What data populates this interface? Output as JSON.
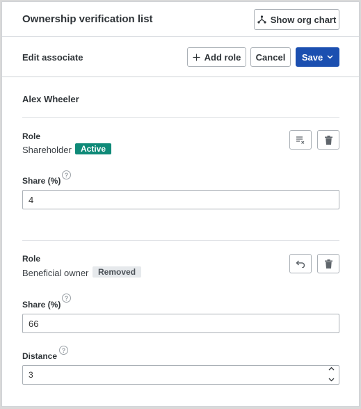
{
  "header": {
    "title": "Ownership verification list",
    "org_chart_label": "Show org chart"
  },
  "subheader": {
    "title": "Edit associate",
    "add_role_label": "Add role",
    "cancel_label": "Cancel",
    "save_label": "Save"
  },
  "associate": {
    "name": "Alex Wheeler"
  },
  "roles": [
    {
      "heading": "Role",
      "type": "Shareholder",
      "status": "Active",
      "share_label": "Share (%)",
      "share_value": "4",
      "action_icon": "clear-format-icon"
    },
    {
      "heading": "Role",
      "type": "Beneficial owner",
      "status": "Removed",
      "share_label": "Share (%)",
      "share_value": "66",
      "distance_label": "Distance",
      "distance_value": "3",
      "action_icon": "undo-icon"
    }
  ],
  "help_glyph": "?",
  "colors": {
    "primary": "#1b4fb0",
    "active_badge": "#0f8a78",
    "removed_badge": "#e6e9ec"
  }
}
